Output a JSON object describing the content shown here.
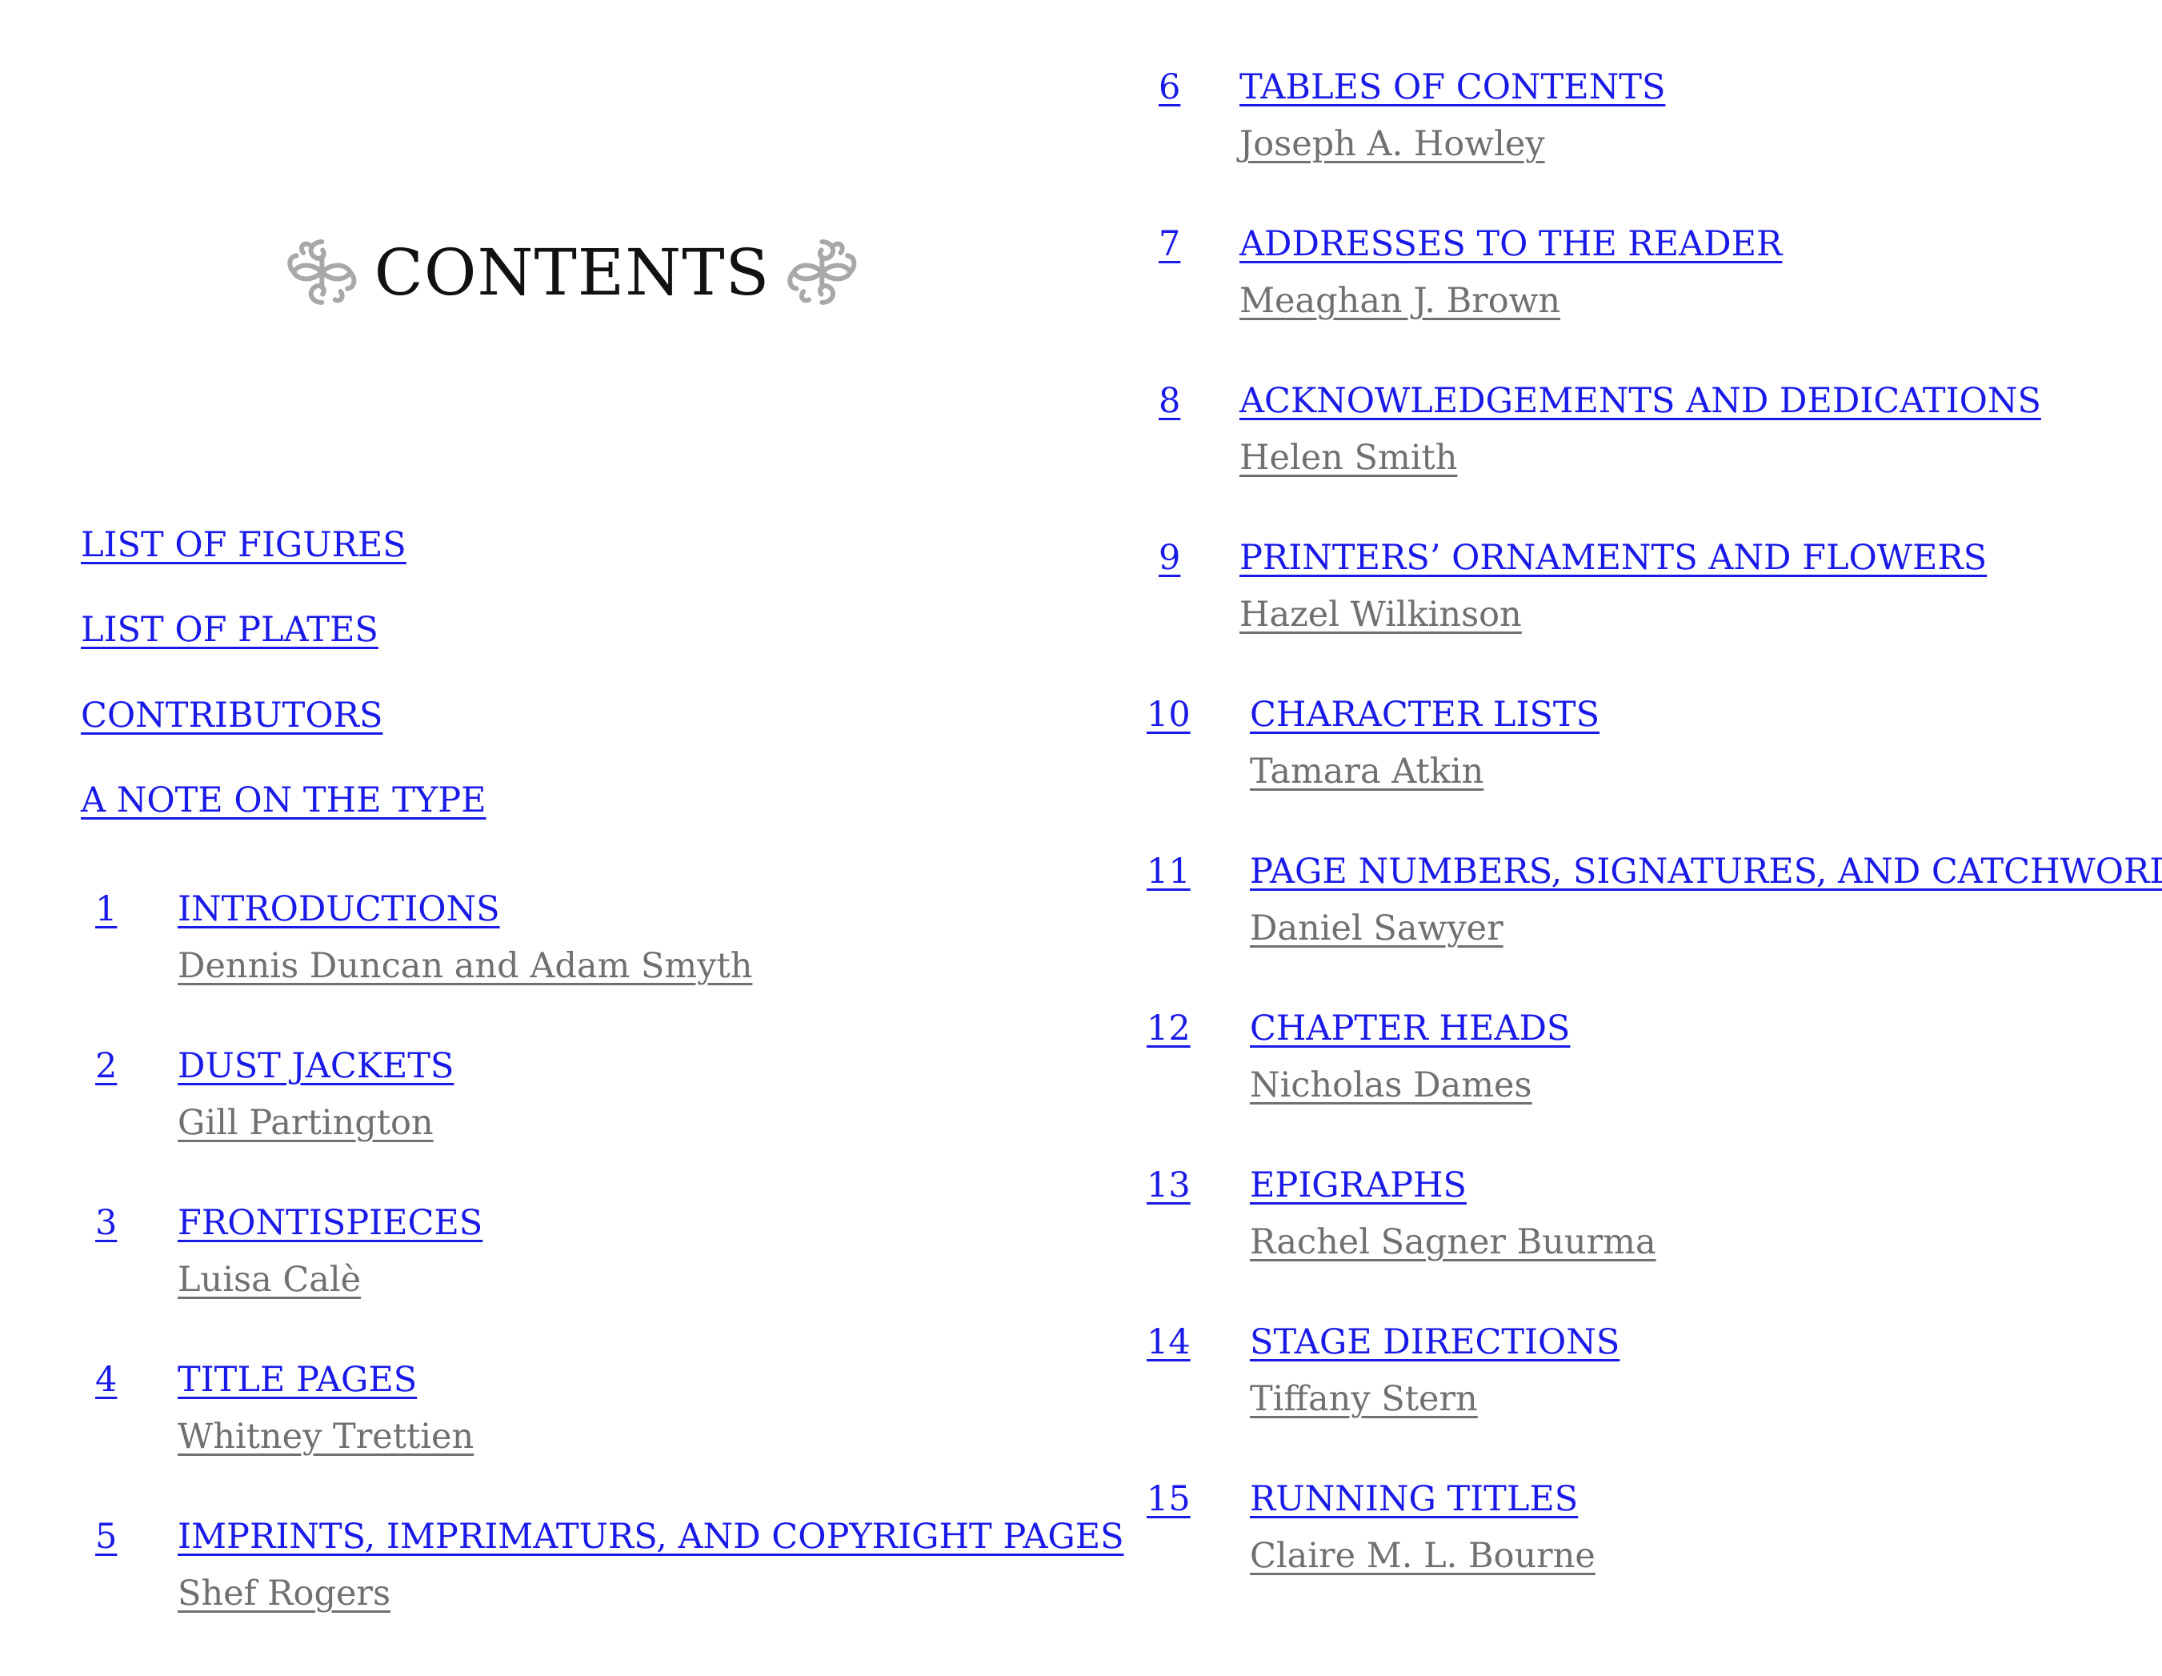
{
  "heading": {
    "title": "CONTENTS",
    "ornament_icon": "fleuron-ornament-icon"
  },
  "colors": {
    "link": "#1a1ae8",
    "author": "#707070",
    "heading": "#111111",
    "ornament": "#a8a8a8"
  },
  "front_matter": [
    "LIST OF FIGURES",
    "LIST OF PLATES",
    "CONTRIBUTORS",
    "A NOTE ON THE TYPE"
  ],
  "chapters": [
    {
      "number": "1",
      "title": "INTRODUCTIONS",
      "author": "Dennis Duncan and Adam Smyth"
    },
    {
      "number": "2",
      "title": "DUST JACKETS",
      "author": "Gill Partington"
    },
    {
      "number": "3",
      "title": "FRONTISPIECES",
      "author": "Luisa Calè"
    },
    {
      "number": "4",
      "title": "TITLE PAGES",
      "author": "Whitney Trettien"
    },
    {
      "number": "5",
      "title": "IMPRINTS, IMPRIMATURS, AND COPYRIGHT PAGES",
      "author": "Shef Rogers"
    },
    {
      "number": "6",
      "title": "TABLES OF CONTENTS",
      "author": "Joseph A. Howley"
    },
    {
      "number": "7",
      "title": "ADDRESSES TO THE READER",
      "author": "Meaghan J. Brown"
    },
    {
      "number": "8",
      "title": "ACKNOWLEDGEMENTS AND DEDICATIONS",
      "author": "Helen Smith"
    },
    {
      "number": "9",
      "title": "PRINTERS’ ORNAMENTS AND FLOWERS",
      "author": "Hazel Wilkinson"
    },
    {
      "number": "10",
      "title": "CHARACTER LISTS",
      "author": "Tamara Atkin"
    },
    {
      "number": "11",
      "title": "PAGE NUMBERS, SIGNATURES, AND CATCHWORDS",
      "author": "Daniel Sawyer"
    },
    {
      "number": "12",
      "title": "CHAPTER HEADS",
      "author": "Nicholas Dames"
    },
    {
      "number": "13",
      "title": "EPIGRAPHS",
      "author": "Rachel Sagner Buurma"
    },
    {
      "number": "14",
      "title": "STAGE DIRECTIONS",
      "author": "Tiffany Stern"
    },
    {
      "number": "15",
      "title": "RUNNING TITLES",
      "author": "Claire M. L. Bourne"
    }
  ]
}
